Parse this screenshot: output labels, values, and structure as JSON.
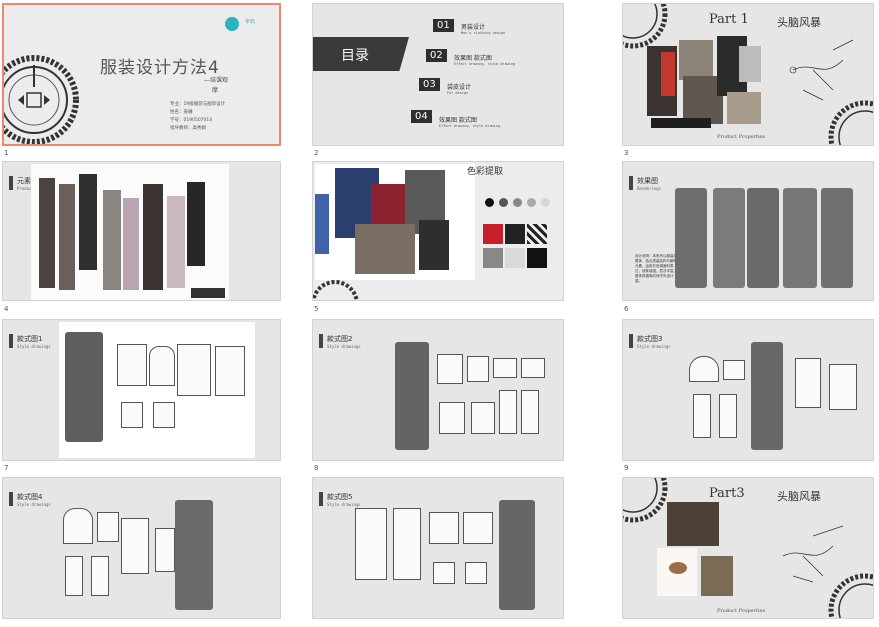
{
  "slides": [
    {
      "num": "1",
      "title": "服装设计方法4",
      "subtitle": "—结课观",
      "subtitle2": "摩",
      "info": [
        "专业：19级服装与服饰设计",
        "姓名：姜姗",
        "学号：0190507014",
        "指导教师：高秀娟"
      ],
      "logo": "字石"
    },
    {
      "num": "2",
      "toc_title": "目录",
      "items": [
        {
          "n": "01",
          "cn": "男装设计",
          "en": "Men's clothing design"
        },
        {
          "n": "02",
          "cn": "效果图 款式图",
          "en": "Effect drawing, style drawing"
        },
        {
          "n": "03",
          "cn": "袋皮设计",
          "en": "Fur design"
        },
        {
          "n": "04",
          "cn": "效果图 款式图",
          "en": "Effect drawing, style drawing"
        }
      ]
    },
    {
      "num": "3",
      "part": "Part 1",
      "brain": "头脑风暴",
      "footer": "Product Properties"
    },
    {
      "num": "4",
      "title": "元素提取",
      "sub": "Product Properties"
    },
    {
      "num": "5",
      "title": "色彩提取"
    },
    {
      "num": "6",
      "title": "效果图",
      "sub": "Renderings",
      "desc": "设计说明：本系列以服装为载体，结合男装结构与解构元素，运用灰色调面料表达，线条感强，层次丰富，整体风格简约而不失设计感。"
    },
    {
      "num": "7",
      "title": "款式图1",
      "sub": "Style drawings"
    },
    {
      "num": "8",
      "title": "款式图2",
      "sub": "Style drawings"
    },
    {
      "num": "9",
      "title": "款式图3",
      "sub": "Style drawings"
    },
    {
      "num": "10",
      "title": "款式图4",
      "sub": "Style drawings"
    },
    {
      "num": "11",
      "title": "款式图5",
      "sub": "Style drawings"
    },
    {
      "num": "12",
      "part": "Part3",
      "brain": "头脑风暴",
      "footer": "Product Properties"
    }
  ],
  "colors": {
    "selected_border": "#f0876a",
    "slide_bg": "#e6e6e6",
    "dark": "#2e2e2e",
    "logo": "#2bb3c0"
  }
}
